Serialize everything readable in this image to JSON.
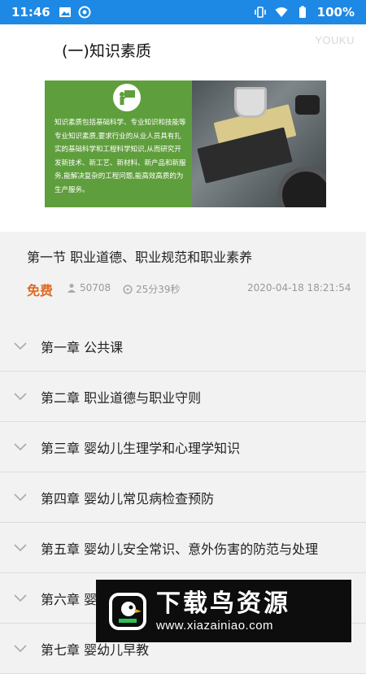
{
  "status_bar": {
    "time": "11:46",
    "battery": "100%",
    "bg_color": "#1e88e5"
  },
  "video": {
    "title": "(一)知识素质",
    "watermark": "YOUKU",
    "slide_text": "知识素质包括基础科学、专业知识和技能等专业知识素质,要求行业的从业人员具有扎实的基础科学和工程科学知识,从而研究开发新技术、新工艺、新材料、新产品和新服务,能解决复杂的工程问题,能高效高质的为生产服务。"
  },
  "lesson": {
    "title": "第一节 职业道德、职业规范和职业素养",
    "price": "免费",
    "views": "50708",
    "duration": "25分39秒",
    "date": "2020-04-18 18:21:54",
    "price_color": "#e06a24"
  },
  "chapters": [
    {
      "label": "第一章 公共课"
    },
    {
      "label": "第二章 职业道德与职业守则"
    },
    {
      "label": "第三章 婴幼儿生理学和心理学知识"
    },
    {
      "label": "第四章 婴幼儿常见病检查预防"
    },
    {
      "label": "第五章 婴幼儿安全常识、意外伤害的防范与处理"
    },
    {
      "label": "第六章 婴"
    },
    {
      "label": "第七章 婴幼儿早教"
    }
  ],
  "banner": {
    "main": "下载鸟资源",
    "url": "www.xiazainiao.com"
  }
}
